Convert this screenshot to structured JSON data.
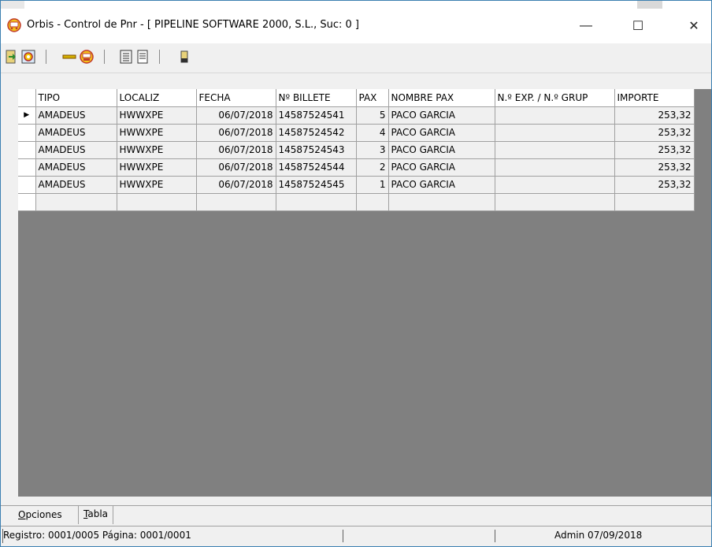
{
  "window": {
    "title": "Orbis - Control de Pnr - [ PIPELINE SOFTWARE 2000, S.L.,  Suc: 0 ]",
    "minimize_glyph": "—",
    "maximize_glyph": "☐",
    "close_glyph": "✕"
  },
  "toolbar": {
    "icons": [
      "exit-door-icon",
      "settings-gear-icon",
      "minus-icon",
      "sticker-icon",
      "list-report-icon",
      "document-icon",
      "door-icon"
    ]
  },
  "grid": {
    "columns": [
      "TIPO",
      "LOCALIZ",
      "FECHA",
      "Nº BILLETE",
      "PAX",
      "NOMBRE PAX",
      "N.º EXP. / N.º GRUP",
      "IMPORTE"
    ],
    "rows": [
      {
        "indicator": "▶",
        "tipo": "AMADEUS",
        "localiz": "HWWXPE",
        "fecha": "06/07/2018",
        "billete": "14587524541",
        "pax": "5",
        "nombre": "PACO GARCIA",
        "exp": "",
        "importe": "253,32"
      },
      {
        "indicator": "",
        "tipo": "AMADEUS",
        "localiz": "HWWXPE",
        "fecha": "06/07/2018",
        "billete": "14587524542",
        "pax": "4",
        "nombre": "PACO GARCIA",
        "exp": "",
        "importe": "253,32"
      },
      {
        "indicator": "",
        "tipo": "AMADEUS",
        "localiz": "HWWXPE",
        "fecha": "06/07/2018",
        "billete": "14587524543",
        "pax": "3",
        "nombre": "PACO GARCIA",
        "exp": "",
        "importe": "253,32"
      },
      {
        "indicator": "",
        "tipo": "AMADEUS",
        "localiz": "HWWXPE",
        "fecha": "06/07/2018",
        "billete": "14587524544",
        "pax": "2",
        "nombre": "PACO GARCIA",
        "exp": "",
        "importe": "253,32"
      },
      {
        "indicator": "",
        "tipo": "AMADEUS",
        "localiz": "HWWXPE",
        "fecha": "06/07/2018",
        "billete": "14587524545",
        "pax": "1",
        "nombre": "PACO GARCIA",
        "exp": "",
        "importe": "253,32"
      },
      {
        "indicator": "",
        "tipo": "",
        "localiz": "",
        "fecha": "",
        "billete": "",
        "pax": "",
        "nombre": "",
        "exp": "",
        "importe": ""
      }
    ]
  },
  "tabs": {
    "opciones_first": "O",
    "opciones_rest": "pciones",
    "tabla_first": "T",
    "tabla_rest": "abla"
  },
  "status": {
    "registro": "Registro: 0001/0005  Página: 0001/0001",
    "user_date": "Admin 07/09/2018"
  },
  "colors": {
    "grid_background": "#808080",
    "window_border": "#3c7fb1"
  }
}
